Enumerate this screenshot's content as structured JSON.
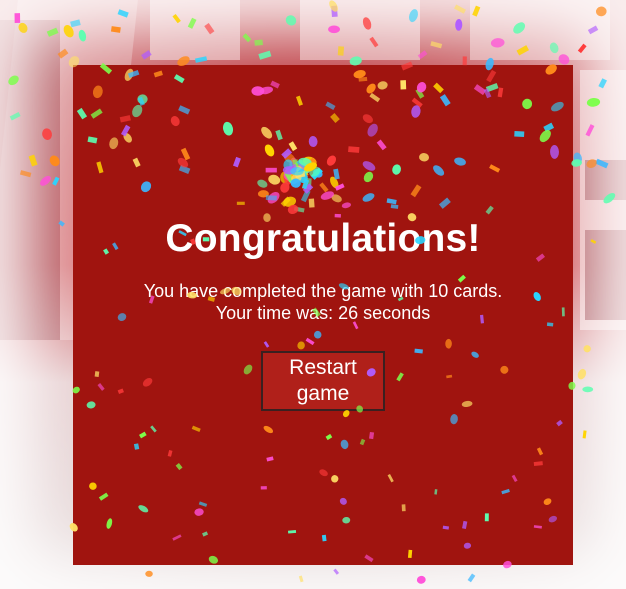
{
  "modal": {
    "title": "Congratulations!",
    "completed_message": "You have completed the game with 10 cards.",
    "time_message": "Your time was: 26 seconds",
    "restart_button_label": "Restart game"
  },
  "colors": {
    "modal_background": "#a0140f",
    "text": "#ffffff",
    "confetti": [
      "#ff4fd8",
      "#ffd400",
      "#2ad4ff",
      "#7cff4a",
      "#ff8a1a",
      "#b05cff",
      "#ff3b3b",
      "#3bb8ff",
      "#ffe066",
      "#5cffb0"
    ]
  }
}
